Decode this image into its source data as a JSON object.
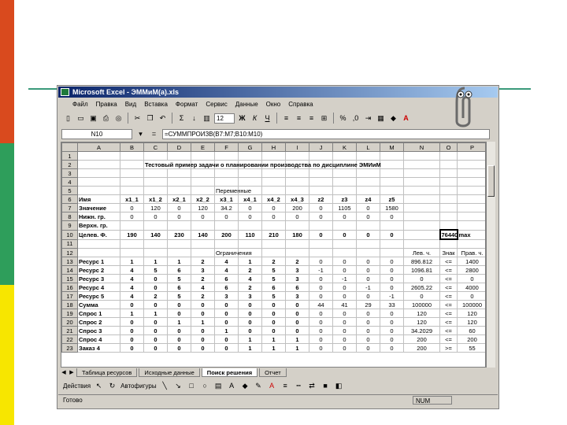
{
  "colors": {
    "band_top": "#d94a1e",
    "band_mid": "#2e9e5b",
    "band_bottom": "#f7e600",
    "accent_line": "#3a9a7a"
  },
  "window": {
    "title": "Microsoft Excel - ЭММиМ(a).xls"
  },
  "menu": [
    "Файл",
    "Правка",
    "Вид",
    "Вставка",
    "Формат",
    "Сервис",
    "Данные",
    "Окно",
    "Справка"
  ],
  "toolbar": {
    "font_size": "12"
  },
  "formula_bar": {
    "cell_ref": "N10",
    "formula": "=СУММПРОИЗВ(B7:M7;B10:M10)"
  },
  "sheet": {
    "columns": [
      "A",
      "B",
      "C",
      "D",
      "E",
      "F",
      "G",
      "H",
      "I",
      "J",
      "K",
      "L",
      "M",
      "N",
      "O",
      "P"
    ],
    "rows": [
      {
        "n": "1",
        "cells": [
          "",
          "",
          "",
          "",
          "",
          "",
          "",
          "",
          "",
          "",
          "",
          "",
          "",
          "",
          "",
          ""
        ]
      },
      {
        "n": "2",
        "cells": [
          "",
          "",
          "Тестовый пример задачи о планировании производства по дисциплине ЭМИиМ",
          "",
          "",
          "",
          "",
          "",
          "",
          "",
          "",
          "",
          "",
          "",
          "",
          ""
        ]
      },
      {
        "n": "3",
        "cells": [
          "",
          "",
          "",
          "",
          "",
          "",
          "",
          "",
          "",
          "",
          "",
          "",
          "",
          "",
          "",
          ""
        ]
      },
      {
        "n": "4",
        "cells": [
          "",
          "",
          "",
          "",
          "",
          "",
          "",
          "",
          "",
          "",
          "",
          "",
          "",
          "",
          "",
          ""
        ]
      },
      {
        "n": "5",
        "cells": [
          "",
          "",
          "",
          "",
          "",
          "Переменные",
          "",
          "",
          "",
          "",
          "",
          "",
          "",
          "",
          "",
          ""
        ]
      },
      {
        "n": "6",
        "cells": [
          "Имя",
          "x1_1",
          "x1_2",
          "x2_1",
          "x2_2",
          "x3_1",
          "x4_1",
          "x4_2",
          "x4_3",
          "z2",
          "z3",
          "z4",
          "z5",
          "",
          "",
          ""
        ]
      },
      {
        "n": "7",
        "cells": [
          "Значение",
          "0",
          "120",
          "0",
          "120",
          "34.2",
          "0",
          "0",
          "200",
          "0",
          "1105",
          "0",
          "1580",
          "",
          "",
          ""
        ]
      },
      {
        "n": "8",
        "cells": [
          "Нижн. гр.",
          "0",
          "0",
          "0",
          "0",
          "0",
          "0",
          "0",
          "0",
          "0",
          "0",
          "0",
          "0",
          "",
          "",
          ""
        ]
      },
      {
        "n": "9",
        "cells": [
          "Верхн. гр.",
          "",
          "",
          "",
          "",
          "",
          "",
          "",
          "",
          "",
          "",
          "",
          "",
          "",
          "",
          ""
        ]
      },
      {
        "n": "10",
        "cells": [
          "Целев. Ф.",
          "190",
          "140",
          "230",
          "140",
          "200",
          "110",
          "210",
          "180",
          "0",
          "0",
          "0",
          "0",
          "",
          "76440.6",
          "max"
        ]
      },
      {
        "n": "11",
        "cells": [
          "",
          "",
          "",
          "",
          "",
          "",
          "",
          "",
          "",
          "",
          "",
          "",
          "",
          "",
          "",
          ""
        ]
      },
      {
        "n": "12",
        "cells": [
          "",
          "",
          "",
          "",
          "",
          "Ограничения",
          "",
          "",
          "",
          "",
          "",
          "",
          "",
          "Лев. ч.",
          "Знак",
          "Прав. ч."
        ]
      },
      {
        "n": "13",
        "cells": [
          "Ресурс 1",
          "1",
          "1",
          "1",
          "2",
          "4",
          "1",
          "2",
          "2",
          "0",
          "0",
          "0",
          "0",
          "896.812",
          "<=",
          "1400"
        ]
      },
      {
        "n": "14",
        "cells": [
          "Ресурс 2",
          "4",
          "5",
          "6",
          "3",
          "4",
          "2",
          "5",
          "3",
          "-1",
          "0",
          "0",
          "0",
          "1096.81",
          "<=",
          "2800"
        ]
      },
      {
        "n": "15",
        "cells": [
          "Ресурс 3",
          "4",
          "0",
          "5",
          "2",
          "6",
          "4",
          "5",
          "3",
          "0",
          "-1",
          "0",
          "0",
          "0",
          "<=",
          "0"
        ]
      },
      {
        "n": "16",
        "cells": [
          "Ресурс 4",
          "4",
          "0",
          "6",
          "4",
          "6",
          "2",
          "6",
          "6",
          "0",
          "0",
          "-1",
          "0",
          "2605.22",
          "<=",
          "4000"
        ]
      },
      {
        "n": "17",
        "cells": [
          "Ресурс 5",
          "4",
          "2",
          "5",
          "2",
          "3",
          "3",
          "5",
          "3",
          "0",
          "0",
          "0",
          "-1",
          "0",
          "<=",
          "0"
        ]
      },
      {
        "n": "18",
        "cells": [
          "Сумма",
          "0",
          "0",
          "0",
          "0",
          "0",
          "0",
          "0",
          "0",
          "44",
          "41",
          "29",
          "33",
          "100000",
          "<=",
          "100000"
        ]
      },
      {
        "n": "19",
        "cells": [
          "Спрос 1",
          "1",
          "1",
          "0",
          "0",
          "0",
          "0",
          "0",
          "0",
          "0",
          "0",
          "0",
          "0",
          "120",
          "<=",
          "120"
        ]
      },
      {
        "n": "20",
        "cells": [
          "Спрос 2",
          "0",
          "0",
          "1",
          "1",
          "0",
          "0",
          "0",
          "0",
          "0",
          "0",
          "0",
          "0",
          "120",
          "<=",
          "120"
        ]
      },
      {
        "n": "21",
        "cells": [
          "Спрос 3",
          "0",
          "0",
          "0",
          "0",
          "1",
          "0",
          "0",
          "0",
          "0",
          "0",
          "0",
          "0",
          "34.2029",
          "<=",
          "60"
        ]
      },
      {
        "n": "22",
        "cells": [
          "Спрос 4",
          "0",
          "0",
          "0",
          "0",
          "0",
          "1",
          "1",
          "1",
          "0",
          "0",
          "0",
          "0",
          "200",
          "<=",
          "200"
        ]
      },
      {
        "n": "23",
        "cells": [
          "Заказ 4",
          "0",
          "0",
          "0",
          "0",
          "0",
          "1",
          "1",
          "1",
          "0",
          "0",
          "0",
          "0",
          "200",
          ">=",
          "55"
        ]
      }
    ]
  },
  "sheet_tabs": [
    "Таблица ресурсов",
    "Исходные данные",
    "Поиск решения",
    "Отчет"
  ],
  "draw_bar": {
    "actions": "Действия",
    "autoshapes": "Автофигуры"
  },
  "status": {
    "ready": "Готово",
    "num": "NUM"
  }
}
